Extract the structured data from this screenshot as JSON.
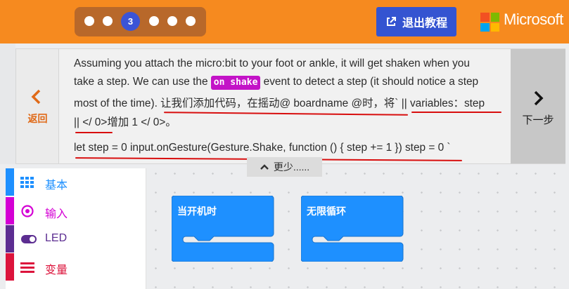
{
  "stepper": {
    "current_step": "3",
    "total_dots": 6
  },
  "header": {
    "exit_label": "退出教程",
    "brand": "Microsoft"
  },
  "tutorial": {
    "back_label": "返回",
    "next_label": "下一步",
    "line1": "Assuming you attach the micro:bit to your foot or ankle, it will get shaken when you",
    "line2_before": "take a step. We can use the ",
    "line2_chip": "on shake",
    "line2_after": " event to detect a step (it should notice a step",
    "line3": "most of the time). 让我们添加代码，在摇动@ boardname @时，将` || variables：step",
    "line4": "|| </ 0>增加 1 </ 0>。",
    "code_line": "let step = 0 input.onGesture(Gesture.Shake, function () { step += 1 }) step = 0 `",
    "more_label": "更少......"
  },
  "toolbox": {
    "categories": [
      {
        "label": "基本",
        "color": "#1e90ff",
        "icon": "grid-icon"
      },
      {
        "label": "输入",
        "color": "#d400d4",
        "icon": "target-icon"
      },
      {
        "label": "LED",
        "color": "#5c2d91",
        "icon": "toggle-icon"
      },
      {
        "label": "变量",
        "color": "#dc143c",
        "icon": "list-icon"
      }
    ]
  },
  "workspace": {
    "blocks": [
      {
        "label": "当开机时"
      },
      {
        "label": "无限循环"
      }
    ]
  },
  "colors": {
    "topbar": "#f68a1f",
    "exit_button": "#3454d1",
    "block": "#1e90ff",
    "annotation": "#d80e0e"
  }
}
